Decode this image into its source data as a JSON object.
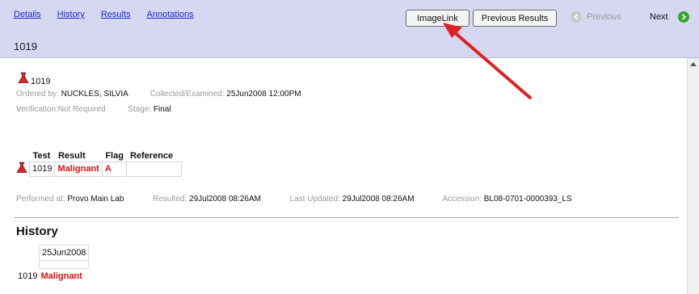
{
  "nav": {
    "links": [
      "Details",
      "History",
      "Results",
      "Annotations"
    ],
    "record_id": "1019"
  },
  "toolbar": {
    "imagelink_label": "ImageLink",
    "previous_results_label": "Previous Results",
    "previous_label": "Previous",
    "next_label": "Next"
  },
  "report": {
    "lab_id": "1019",
    "ordered_by_label": "Ordered by:",
    "ordered_by": "NUCKLES, SILVIA",
    "collected_label": "Collected/Examined:",
    "collected": "25Jun2008 12:00PM",
    "verification_label": "Verification:",
    "verification": "Not Required",
    "stage_label": "Stage:",
    "stage": "Final"
  },
  "results": {
    "headers": [
      "Test",
      "Result",
      "Flag",
      "Reference"
    ],
    "row": {
      "test": "1019",
      "result": "Malignant",
      "flag": "A",
      "reference": ""
    }
  },
  "performed": {
    "performed_at_label": "Performed at:",
    "performed_at": "Provo Main Lab",
    "resulted_label": "Resulted:",
    "resulted": "29Jul2008 08:26AM",
    "last_updated_label": "Last Updated:",
    "last_updated": "29Jul2008 08:26AM",
    "accession_label": "Accession:",
    "accession": "BL08-0701-0000393_LS"
  },
  "history": {
    "title": "History",
    "date": "25Jun2008",
    "test": "1019",
    "result": "Malignant"
  },
  "colors": {
    "header_bg": "#d6d8f2",
    "link": "#1a2cc8",
    "abnormal": "#e01010",
    "next_icon": "#33a82a",
    "annotation_arrow": "#e02020"
  },
  "icons": [
    "flask-icon",
    "previous-arrow-icon",
    "next-arrow-icon",
    "scroll-up-icon"
  ]
}
